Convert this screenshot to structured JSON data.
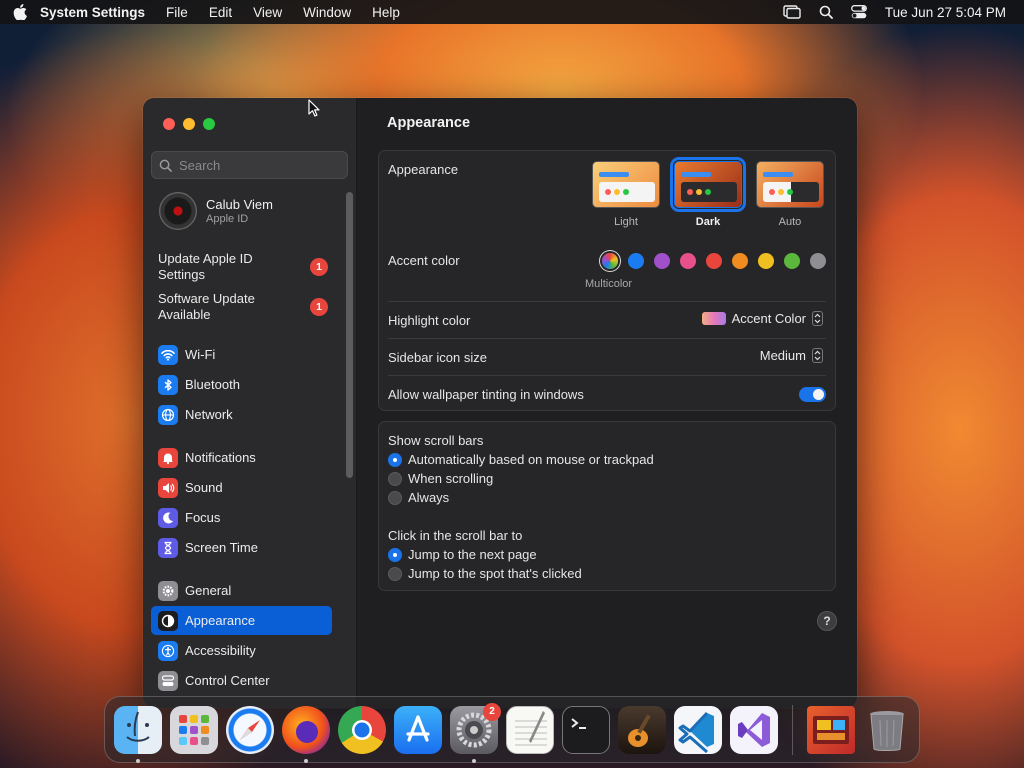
{
  "menubar": {
    "app_name": "System Settings",
    "menus": [
      "File",
      "Edit",
      "View",
      "Window",
      "Help"
    ],
    "datetime": "Tue Jun 27  5:04 PM"
  },
  "sidebar": {
    "search_placeholder": "Search",
    "account": {
      "name": "Calub Viem",
      "subtitle": "Apple ID"
    },
    "notices": [
      {
        "label": "Update Apple ID Settings",
        "badge": "1"
      },
      {
        "label": "Software Update Available",
        "badge": "1"
      }
    ],
    "items": [
      {
        "label": "Wi-Fi",
        "icon": "wifi-icon",
        "color": "#1a7cf0"
      },
      {
        "label": "Bluetooth",
        "icon": "bluetooth-icon",
        "color": "#1a7cf0"
      },
      {
        "label": "Network",
        "icon": "globe-icon",
        "color": "#1a7cf0"
      },
      {
        "label": "Notifications",
        "icon": "bell-icon",
        "color": "#e8453c"
      },
      {
        "label": "Sound",
        "icon": "speaker-icon",
        "color": "#e8453c"
      },
      {
        "label": "Focus",
        "icon": "moon-icon",
        "color": "#5e5ce6"
      },
      {
        "label": "Screen Time",
        "icon": "hourglass-icon",
        "color": "#5e5ce6"
      },
      {
        "label": "General",
        "icon": "gear-icon",
        "color": "#8e8e93"
      },
      {
        "label": "Appearance",
        "icon": "appearance-icon",
        "color": "#1c1c1e",
        "active": true
      },
      {
        "label": "Accessibility",
        "icon": "accessibility-icon",
        "color": "#1a7cf0"
      },
      {
        "label": "Control Center",
        "icon": "control-center-icon",
        "color": "#8e8e93"
      }
    ]
  },
  "content": {
    "title": "Appearance",
    "appearance": {
      "label": "Appearance",
      "options": [
        "Light",
        "Dark",
        "Auto"
      ],
      "selected": "Dark"
    },
    "accent": {
      "label": "Accent color",
      "selected_caption": "Multicolor",
      "colors": [
        "#8e5ce6",
        "#1a7cf0",
        "#a050c8",
        "#e8508c",
        "#e8453c",
        "#f08c20",
        "#f0c020",
        "#5cb83c",
        "#8e8e93"
      ]
    },
    "highlight": {
      "label": "Highlight color",
      "value": "Accent Color"
    },
    "sidebar_icon_size": {
      "label": "Sidebar icon size",
      "value": "Medium"
    },
    "wallpaper_tinting": {
      "label": "Allow wallpaper tinting in windows",
      "on": true
    },
    "scroll_bars": {
      "label": "Show scroll bars",
      "options": [
        "Automatically based on mouse or trackpad",
        "When scrolling",
        "Always"
      ],
      "selected": 0
    },
    "click_scroll_bar": {
      "label": "Click in the scroll bar to",
      "options": [
        "Jump to the next page",
        "Jump to the spot that's clicked"
      ],
      "selected": 0
    },
    "help": "?"
  },
  "dock": {
    "apps": [
      {
        "name": "finder-icon",
        "running": true
      },
      {
        "name": "launchpad-icon",
        "running": false
      },
      {
        "name": "safari-icon",
        "running": false
      },
      {
        "name": "firefox-icon",
        "running": true
      },
      {
        "name": "chrome-icon",
        "running": false
      },
      {
        "name": "app-store-icon",
        "running": false
      },
      {
        "name": "system-settings-icon",
        "running": true,
        "badge": "2"
      },
      {
        "name": "textedit-icon",
        "running": false
      },
      {
        "name": "terminal-icon",
        "running": false
      },
      {
        "name": "garageband-icon",
        "running": false
      },
      {
        "name": "vscode-icon",
        "running": false
      },
      {
        "name": "visual-studio-icon",
        "running": false
      }
    ],
    "extras": [
      "downloads-stack-icon",
      "trash-icon"
    ]
  }
}
